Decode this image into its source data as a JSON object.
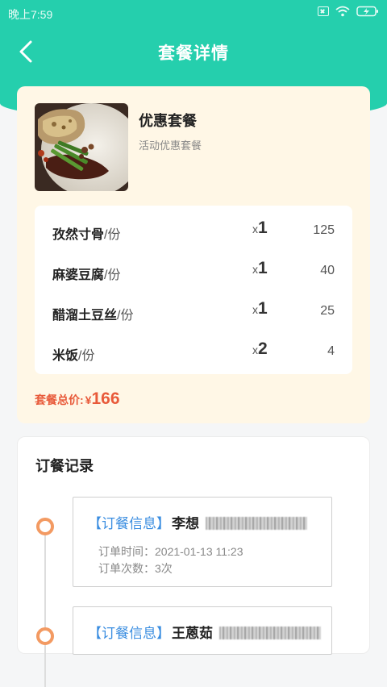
{
  "status_bar": {
    "time": "晚上7:59"
  },
  "nav": {
    "title": "套餐详情"
  },
  "package": {
    "name": "优惠套餐",
    "description": "活动优惠套餐",
    "items": [
      {
        "name": "孜然寸骨",
        "unit": "/份",
        "qty_prefix": "x",
        "qty": "1",
        "price": "125"
      },
      {
        "name": "麻婆豆腐",
        "unit": "/份",
        "qty_prefix": "x",
        "qty": "1",
        "price": "40"
      },
      {
        "name": "醋溜土豆丝",
        "unit": "/份",
        "qty_prefix": "x",
        "qty": "1",
        "price": "25"
      },
      {
        "name": "米饭",
        "unit": "/份",
        "qty_prefix": "x",
        "qty": "2",
        "price": "4"
      }
    ],
    "total_label": "套餐总价:",
    "total_currency": "¥",
    "total_value": "166"
  },
  "records": {
    "title": "订餐记录",
    "entries": [
      {
        "tag": "【订餐信息】",
        "name": "李想",
        "time_line": "订单时间：2021-01-13 11:23",
        "count_line": "订单次数：3次"
      },
      {
        "tag": "【订餐信息】",
        "name": "王蒽茹"
      }
    ]
  },
  "colors": {
    "primary": "#25cfad",
    "accent": "#e85a3a",
    "tag": "#3a8de0",
    "card_bg": "#fff7e6",
    "dot": "#f39a62"
  }
}
